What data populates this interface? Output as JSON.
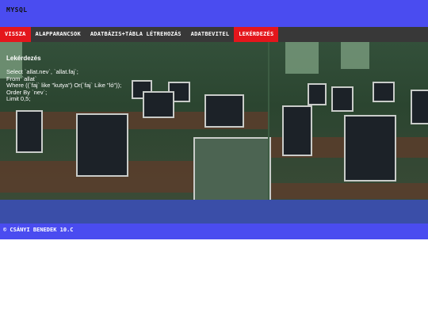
{
  "header": {
    "title": "MYSQL"
  },
  "nav": {
    "items": [
      {
        "label": "VISSZA",
        "active": true
      },
      {
        "label": "ALAPPARANCSOK",
        "active": false
      },
      {
        "label": "ADATBÁZIS+TÁBLA LÉTREHOZÁS",
        "active": false
      },
      {
        "label": "ADATBEVITEL",
        "active": false
      },
      {
        "label": "LEKÉRDEZÉS",
        "active": true
      }
    ]
  },
  "content": {
    "heading": "Lekérdezés",
    "code": [
      "Select `allat.nev`, `allat.faj`;",
      "From `allat`",
      "Where ((`faj` like \"kutya\") Or(`faj` Like \"ló\"));",
      "Order By `nev`;",
      "Limit 0,5;"
    ]
  },
  "footer": {
    "text": "© CSÁNYI BENEDEK 10.C"
  },
  "colors": {
    "page_bg": "#4a4cf0",
    "nav_bg": "#383838",
    "nav_active": "#e4161c",
    "band": "#3a4ea8"
  }
}
